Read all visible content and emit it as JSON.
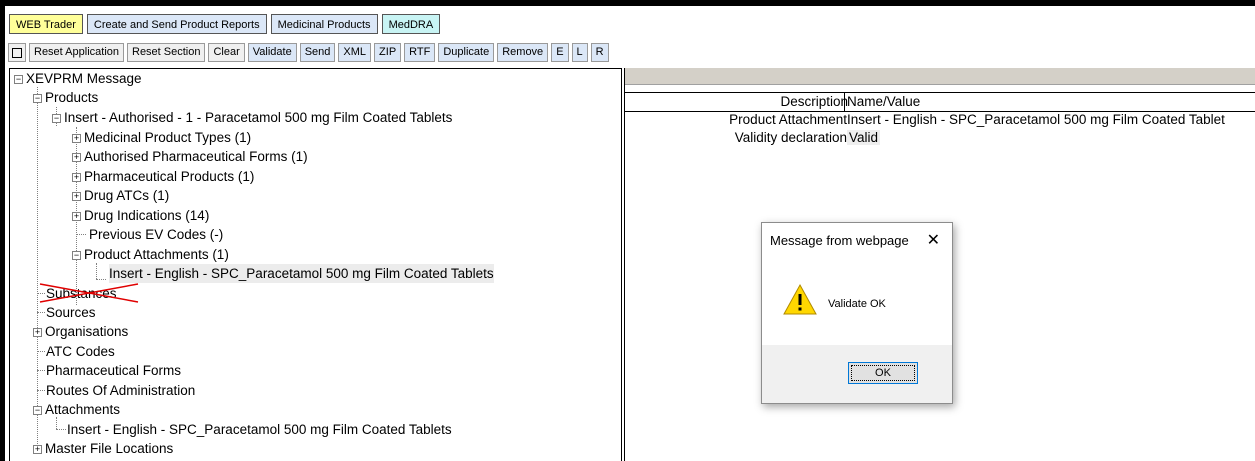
{
  "tabs": [
    "WEB Trader",
    "Create and Send Product Reports",
    "Medicinal Products",
    "MedDRA"
  ],
  "toolbar": {
    "buttons": [
      "Reset Application",
      "Reset Section",
      "Clear"
    ],
    "blue_buttons": [
      "Validate",
      "Send",
      "XML",
      "ZIP",
      "RTF",
      "Duplicate",
      "Remove",
      "E",
      "L",
      "R"
    ]
  },
  "tree": {
    "root": "XEVPRM Message",
    "products": "Products",
    "insert": "Insert - Authorised - 1 - Paracetamol 500 mg Film Coated Tablets",
    "medicinal_product_types": "Medicinal Product Types (1)",
    "authorised_pharmaceutical_forms": "Authorised Pharmaceutical Forms (1)",
    "pharmaceutical_products": "Pharmaceutical Products (1)",
    "drug_atcs": "Drug ATCs (1)",
    "drug_indications": "Drug Indications (14)",
    "previous_ev_codes": "Previous EV Codes (-)",
    "product_attachments": "Product Attachments (1)",
    "attachment_item": "Insert - English - SPC_Paracetamol 500 mg Film Coated Tablets",
    "substances": "Substances",
    "sources": "Sources",
    "organisations": "Organisations",
    "atc_codes": "ATC Codes",
    "pharmaceutical_forms": "Pharmaceutical Forms",
    "routes_of_administration": "Routes Of Administration",
    "attachments": "Attachments",
    "attachments_item": "Insert - English - SPC_Paracetamol 500 mg Film Coated Tablets",
    "master_file_locations": "Master File Locations"
  },
  "details": {
    "header_description": "Description",
    "header_value": "Name/Value",
    "rows": [
      {
        "label": "Product Attachment",
        "value": "Insert - English - SPC_Paracetamol 500 mg Film Coated Tablet"
      },
      {
        "label": "Validity declaration",
        "value": "Valid"
      }
    ]
  },
  "dialog": {
    "title": "Message from webpage",
    "close": "✕",
    "message": "Validate OK",
    "ok": "OK",
    "icon": "warning-icon"
  },
  "colors": {
    "web_tab": "#ffff99",
    "blue_tab": "#dbe7f7",
    "meddra_tab": "#c8f4f4",
    "strike": "#e00000",
    "warning": "#ffd700"
  }
}
